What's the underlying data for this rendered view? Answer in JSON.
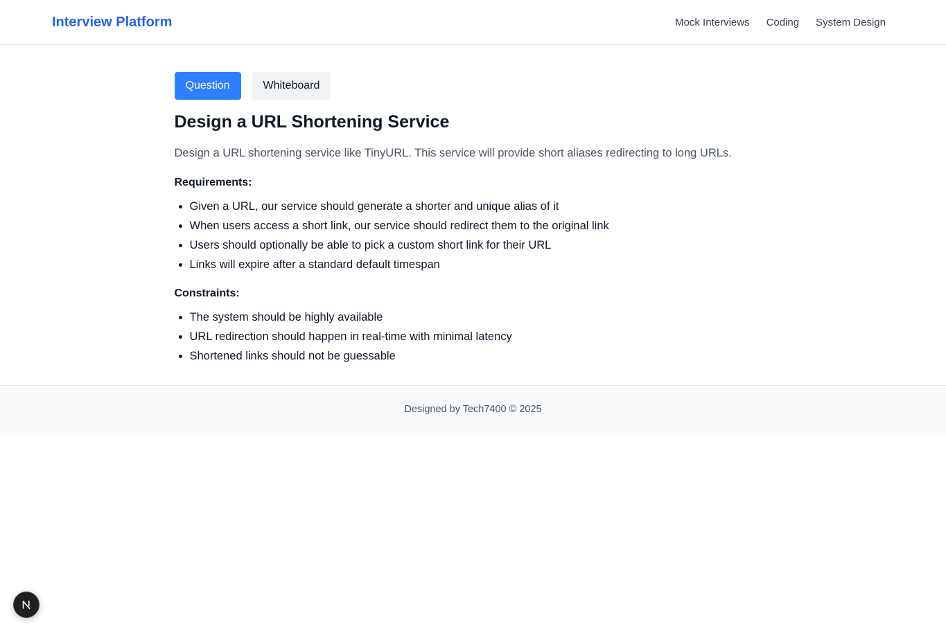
{
  "header": {
    "brand": "Interview Platform",
    "nav": [
      "Mock Interviews",
      "Coding",
      "System Design"
    ]
  },
  "tabs": {
    "question": "Question",
    "whiteboard": "Whiteboard",
    "active": "Question"
  },
  "question": {
    "title": "Design a URL Shortening Service",
    "description": "Design a URL shortening service like TinyURL. This service will provide short aliases redirecting to long URLs.",
    "requirements_heading": "Requirements:",
    "requirements": [
      "Given a URL, our service should generate a shorter and unique alias of it",
      "When users access a short link, our service should redirect them to the original link",
      "Users should optionally be able to pick a custom short link for their URL",
      "Links will expire after a standard default timespan"
    ],
    "constraints_heading": "Constraints:",
    "constraints": [
      "The system should be highly available",
      "URL redirection should happen in real-time with minimal latency",
      "Shortened links should not be guessable"
    ]
  },
  "footer": {
    "text": "Designed by Tech7400 © 2025"
  },
  "colors": {
    "brand": "#2563eb",
    "active_tab": "#2f80ff",
    "inactive_tab": "#f1f2f4"
  },
  "icons": {
    "dev_badge": "nextjs-logo-icon"
  }
}
